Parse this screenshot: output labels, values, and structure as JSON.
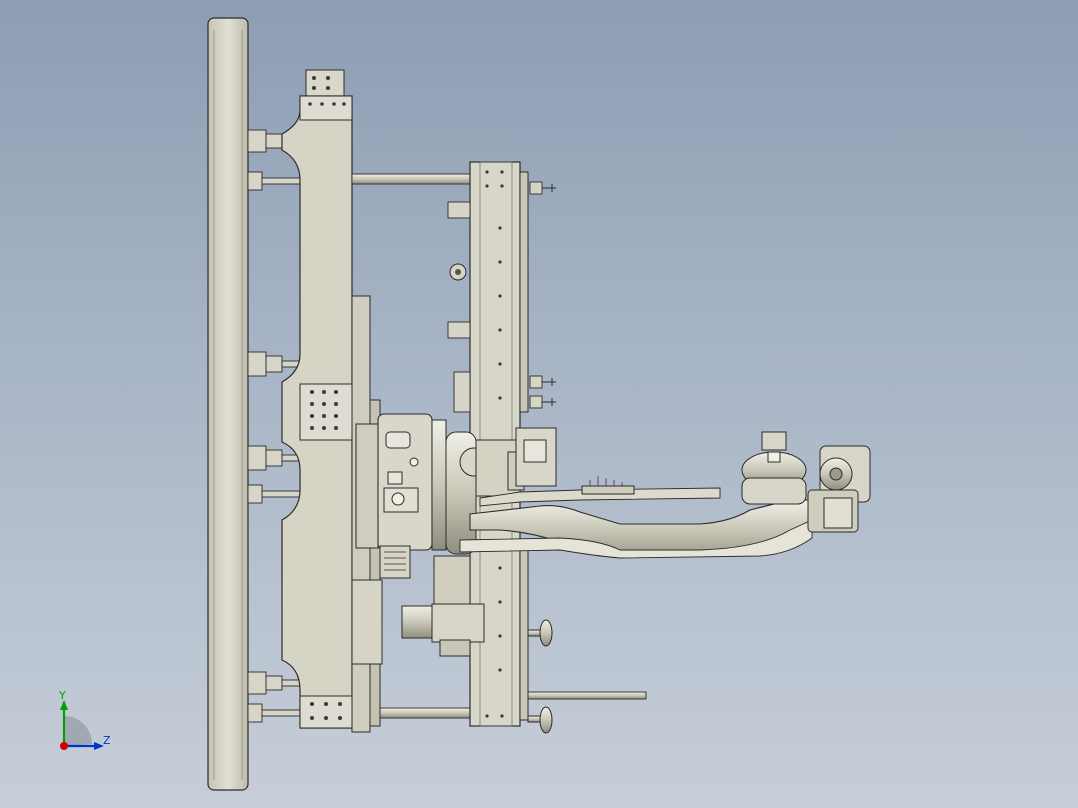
{
  "viewport": {
    "description_free": true,
    "background_top": "#8d9db2",
    "background_bottom": "#c7ced9"
  },
  "colors": {
    "part_fill": "#d7d5c7",
    "part_fill_dark": "#bcbaa9",
    "edge": "#2b2b2b",
    "shadow": "#9a9888",
    "axis_x": "#d40000",
    "axis_y": "#00a000",
    "axis_z": "#0033cc"
  },
  "triad": {
    "x_label": "",
    "y_label": "Y",
    "z_label": "Z"
  }
}
